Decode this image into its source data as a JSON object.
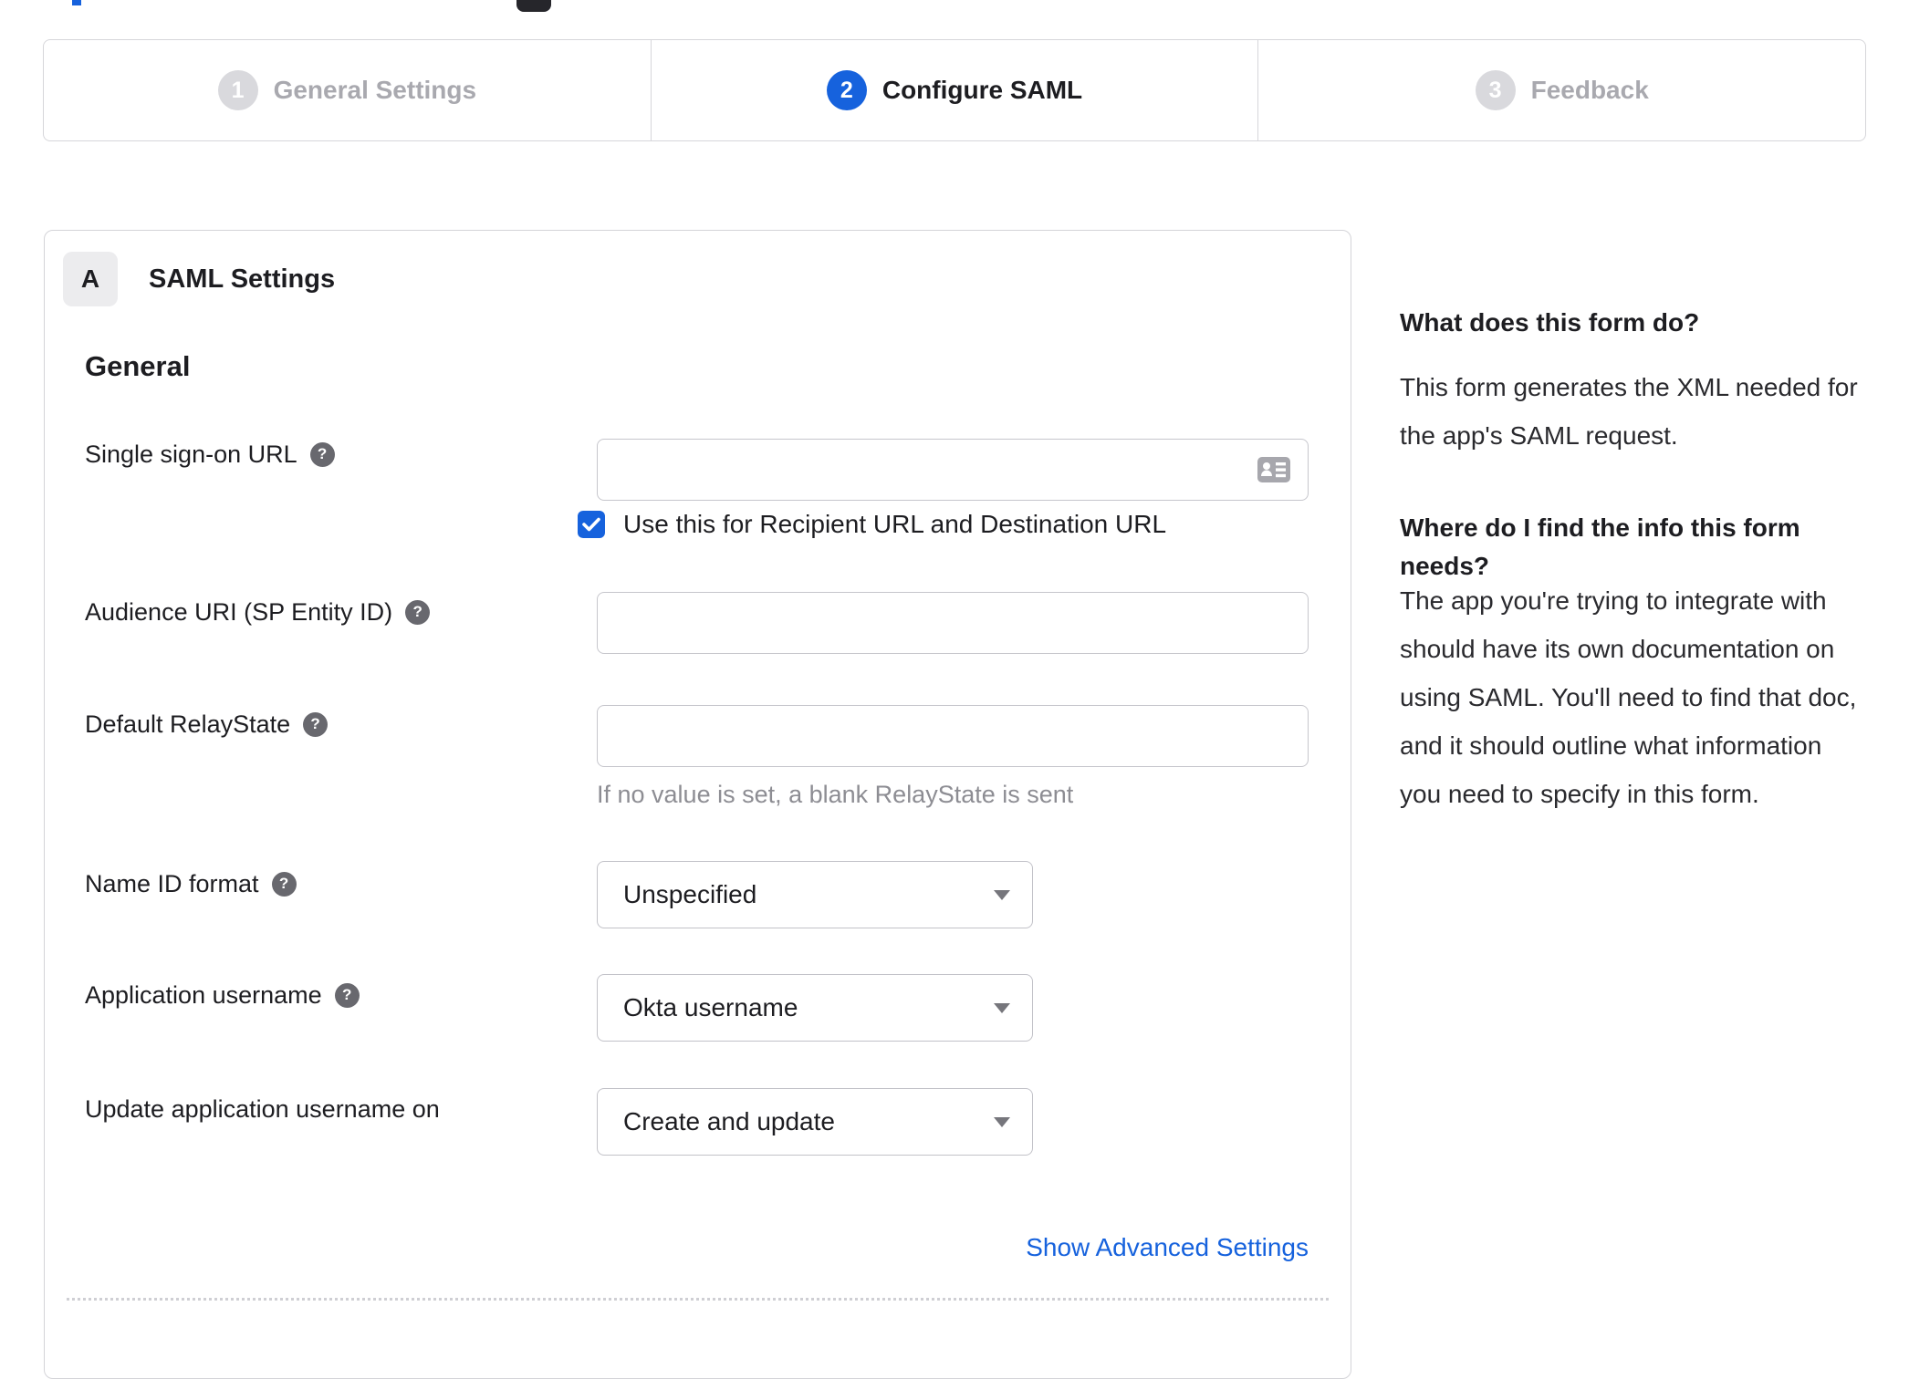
{
  "colors": {
    "accent_blue": "#1662dd",
    "inactive_circle_gray": "#d9d9dd",
    "inactive_label_gray": "#a9a9af",
    "border_gray": "#d6d6da",
    "text_dark": "#1d1d21",
    "hint_gray": "#8d8d93",
    "help_icon_bg": "#68686e",
    "field_icon_gray": "#a7a7ad"
  },
  "icons": {
    "help_glyph": "?"
  },
  "stepper": {
    "steps": [
      {
        "number": "1",
        "label": "General Settings",
        "active": false
      },
      {
        "number": "2",
        "label": "Configure SAML",
        "active": true
      },
      {
        "number": "3",
        "label": "Feedback",
        "active": false
      }
    ]
  },
  "panel": {
    "badge": "A",
    "title": "SAML Settings",
    "section_heading": "General",
    "fields": [
      {
        "label": "Single sign-on URL",
        "type": "text",
        "value": "",
        "checkbox_label": "Use this for Recipient URL and Destination URL",
        "checkbox_checked": true
      },
      {
        "label": "Audience URI (SP Entity ID)",
        "type": "text",
        "value": ""
      },
      {
        "label": "Default RelayState",
        "type": "text",
        "value": "",
        "hint": "If no value is set, a blank RelayState is sent"
      },
      {
        "label": "Name ID format",
        "type": "select",
        "value": "Unspecified"
      },
      {
        "label": "Application username",
        "type": "select",
        "value": "Okta username"
      },
      {
        "label": "Update application username on",
        "type": "select",
        "value": "Create and update"
      }
    ],
    "advanced_settings_link": "Show Advanced Settings"
  },
  "sidebar": {
    "heading_1": "What does this form do?",
    "paragraph_1": "This form generates the XML needed for the app's SAML request.",
    "heading_2": "Where do I find the info this form needs?",
    "paragraph_2": "The app you're trying to integrate with should have its own documentation on using SAML. You'll need to find that doc, and it should outline what information you need to specify in this form."
  }
}
